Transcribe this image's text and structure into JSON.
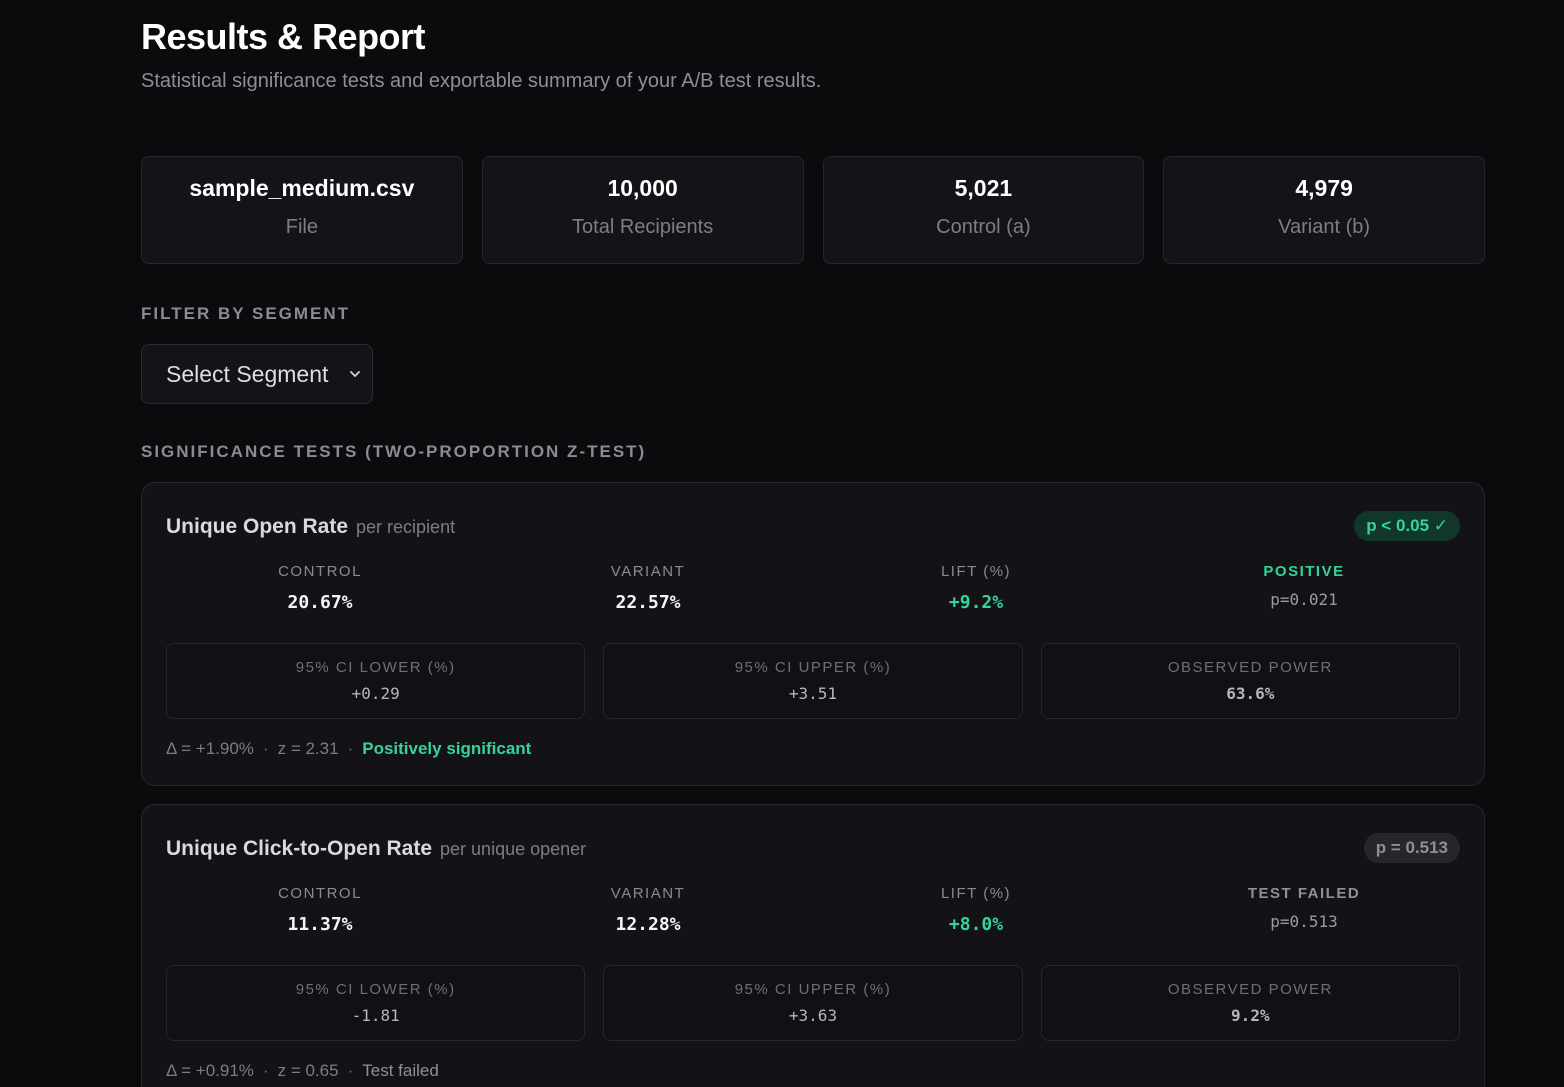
{
  "page": {
    "title": "Results & Report",
    "subtitle": "Statistical significance tests and exportable summary of your A/B test results."
  },
  "stats": [
    {
      "value": "sample_medium.csv",
      "label": "File"
    },
    {
      "value": "10,000",
      "label": "Total Recipients"
    },
    {
      "value": "5,021",
      "label": "Control (a)"
    },
    {
      "value": "4,979",
      "label": "Variant (b)"
    }
  ],
  "filter": {
    "label": "FILTER BY SEGMENT",
    "selected": "Select Segment"
  },
  "significance": {
    "label": "SIGNIFICANCE TESTS (TWO-PROPORTION Z-TEST)",
    "tests": [
      {
        "title": "Unique Open Rate",
        "unit": "per recipient",
        "badge": "p < 0.05 ✓",
        "control_label": "CONTROL",
        "control": "20.67%",
        "variant_label": "VARIANT",
        "variant": "22.57%",
        "lift_label": "LIFT (%)",
        "lift": "+9.2%",
        "verdict_head": "POSITIVE",
        "pvalue": "p=0.021",
        "ci_lower_label": "95% CI LOWER (%)",
        "ci_lower": "+0.29",
        "ci_upper_label": "95% CI UPPER (%)",
        "ci_upper": "+3.51",
        "power_label": "OBSERVED POWER",
        "power": "63.6%",
        "delta": "Δ = +1.90%",
        "z": "z = 2.31",
        "verdict": "Positively significant",
        "colors": {
          "badge": "#34d399",
          "power": "#fbbf24"
        }
      },
      {
        "title": "Unique Click-to-Open Rate",
        "unit": "per unique opener",
        "badge": "p = 0.513",
        "control_label": "CONTROL",
        "control": "11.37%",
        "variant_label": "VARIANT",
        "variant": "12.28%",
        "lift_label": "LIFT (%)",
        "lift": "+8.0%",
        "verdict_head": "TEST FAILED",
        "pvalue": "p=0.513",
        "ci_lower_label": "95% CI LOWER (%)",
        "ci_lower": "-1.81",
        "ci_upper_label": "95% CI UPPER (%)",
        "ci_upper": "+3.63",
        "power_label": "OBSERVED POWER",
        "power": "9.2%",
        "delta": "Δ = +0.91%",
        "z": "z = 0.65",
        "verdict": "Test failed",
        "colors": {
          "badge": "#8f8f97",
          "power": "#f87171"
        }
      }
    ]
  },
  "icons": {
    "select_chevron": "chevron-down-icon"
  }
}
